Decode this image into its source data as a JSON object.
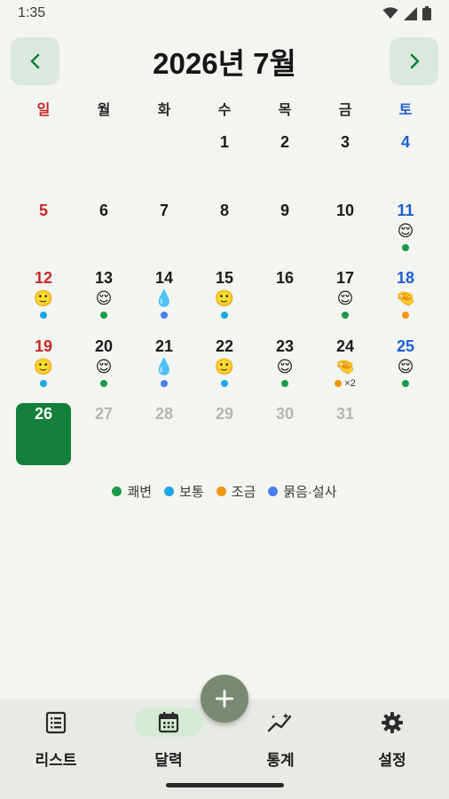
{
  "status": {
    "time": "1:35"
  },
  "header": {
    "title": "2026년 7월"
  },
  "weekdays": [
    "일",
    "월",
    "화",
    "수",
    "목",
    "금",
    "토"
  ],
  "colors": {
    "good": "#1a9a4a",
    "normal": "#1ea7e8",
    "little": "#f0960f",
    "loose": "#4a7ff0",
    "today_bg": "#137f3b",
    "accent": "#137f3b"
  },
  "calendar": {
    "leading_blanks": 3,
    "days": [
      {
        "num": "1"
      },
      {
        "num": "2"
      },
      {
        "num": "3"
      },
      {
        "num": "4"
      },
      {
        "num": "5"
      },
      {
        "num": "6"
      },
      {
        "num": "7"
      },
      {
        "num": "8"
      },
      {
        "num": "9"
      },
      {
        "num": "10"
      },
      {
        "num": "11",
        "mood": "😌",
        "dots": [
          "good"
        ]
      },
      {
        "num": "12",
        "mood": "🙂",
        "dots": [
          "normal"
        ]
      },
      {
        "num": "13",
        "mood": "😌",
        "dots": [
          "good"
        ]
      },
      {
        "num": "14",
        "mood": "💧",
        "dots": [
          "loose"
        ]
      },
      {
        "num": "15",
        "mood": "🙂",
        "dots": [
          "normal"
        ]
      },
      {
        "num": "16"
      },
      {
        "num": "17",
        "mood": "😌",
        "dots": [
          "good"
        ]
      },
      {
        "num": "18",
        "mood": "🤏",
        "dots": [
          "little"
        ]
      },
      {
        "num": "19",
        "mood": "🙂",
        "dots": [
          "normal"
        ]
      },
      {
        "num": "20",
        "mood": "😌",
        "dots": [
          "good"
        ]
      },
      {
        "num": "21",
        "mood": "💧",
        "dots": [
          "loose"
        ]
      },
      {
        "num": "22",
        "mood": "🙂",
        "dots": [
          "normal"
        ]
      },
      {
        "num": "23",
        "mood": "😌",
        "dots": [
          "good"
        ]
      },
      {
        "num": "24",
        "mood": "🤏",
        "dots": [
          "little"
        ],
        "count": "×2"
      },
      {
        "num": "25",
        "mood": "😌",
        "dots": [
          "good"
        ]
      },
      {
        "num": "26",
        "today": true
      },
      {
        "num": "27",
        "faded": true
      },
      {
        "num": "28",
        "faded": true
      },
      {
        "num": "29",
        "faded": true
      },
      {
        "num": "30",
        "faded": true
      },
      {
        "num": "31",
        "faded": true
      }
    ]
  },
  "legend": [
    {
      "key": "good",
      "label": "쾌변"
    },
    {
      "key": "normal",
      "label": "보통"
    },
    {
      "key": "little",
      "label": "조금"
    },
    {
      "key": "loose",
      "label": "묽음·설사"
    }
  ],
  "nav": [
    {
      "label": "리스트",
      "icon": "list-icon"
    },
    {
      "label": "달력",
      "icon": "calendar-icon",
      "active": true
    },
    {
      "label": "통계",
      "icon": "stats-icon"
    },
    {
      "label": "설정",
      "icon": "gear-icon"
    }
  ],
  "fab": {
    "icon": "plus-icon"
  }
}
